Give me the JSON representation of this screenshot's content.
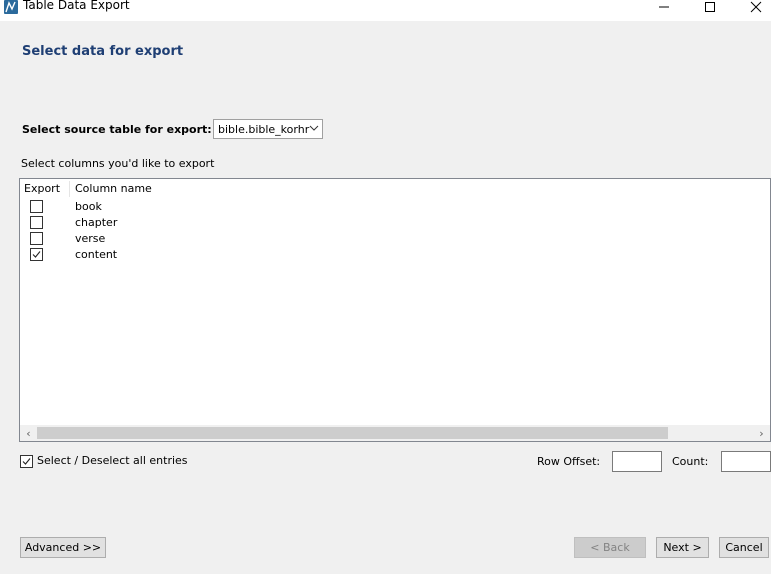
{
  "window": {
    "title": "Table Data Export",
    "minimize_glyph": "—",
    "maximize_glyph": "☐",
    "close_glyph": "✕"
  },
  "page": {
    "heading": "Select data for export",
    "source_label": "Select source table for export:",
    "source_value": "bible.bible_korhr",
    "columns_label": "Select columns you'd like to export"
  },
  "table": {
    "headers": [
      "Export",
      "Column name"
    ],
    "rows": [
      {
        "name": "book",
        "checked": false
      },
      {
        "name": "chapter",
        "checked": false
      },
      {
        "name": "verse",
        "checked": false
      },
      {
        "name": "content",
        "checked": true
      }
    ],
    "scroll_left": "‹",
    "scroll_right": "›"
  },
  "footer": {
    "select_all_label": "Select / Deselect all entries",
    "select_all_checked": true,
    "row_offset_label": "Row Offset:",
    "row_offset_value": "",
    "count_label": "Count:",
    "count_value": ""
  },
  "buttons": {
    "advanced": "Advanced >>",
    "back": "< Back",
    "next": "Next >",
    "cancel": "Cancel"
  },
  "colors": {
    "heading": "#1f3f74",
    "app_icon": "#2b6a9c"
  }
}
